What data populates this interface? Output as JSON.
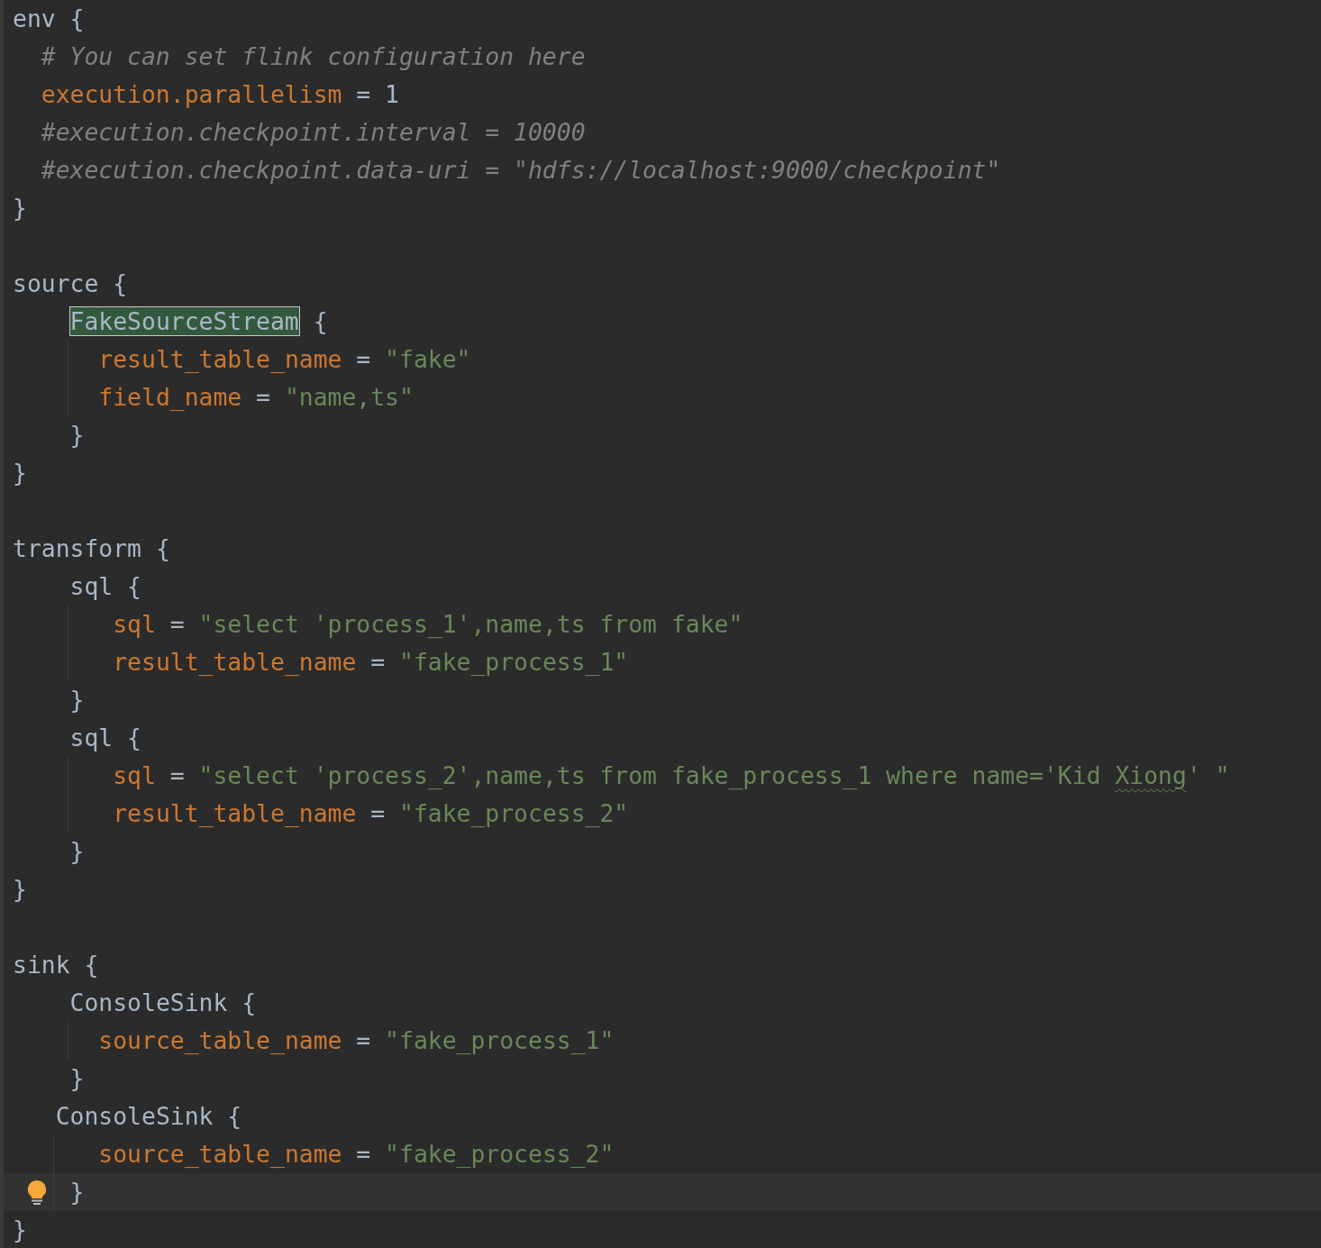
{
  "editor": {
    "lines": [
      {
        "current": false,
        "kind": "top",
        "tokens": [
          {
            "kind": "plain",
            "text": "env {"
          }
        ]
      },
      {
        "current": false,
        "kind": "property",
        "tokens": [
          {
            "kind": "comment",
            "text": "# You can set flink configuration here"
          }
        ]
      },
      {
        "current": false,
        "kind": "property",
        "tokens": [
          {
            "kind": "key",
            "text": "execution.parallelism"
          },
          {
            "kind": "plain",
            "text": " = "
          },
          {
            "kind": "number",
            "text": "1"
          }
        ]
      },
      {
        "current": false,
        "kind": "property",
        "tokens": [
          {
            "kind": "comment",
            "text": "#execution.checkpoint.interval = 10000"
          }
        ]
      },
      {
        "current": false,
        "kind": "property",
        "tokens": [
          {
            "kind": "comment",
            "text": "#execution.checkpoint.data-uri = \"hdfs://localhost:9000/checkpoint\""
          }
        ]
      },
      {
        "current": false,
        "kind": "top",
        "tokens": [
          {
            "kind": "plain",
            "text": "}"
          }
        ]
      },
      {
        "current": false,
        "kind": "top"
      },
      {
        "current": false,
        "kind": "top",
        "tokens": [
          {
            "kind": "plain",
            "text": "source {"
          }
        ]
      },
      {
        "current": false,
        "kind": "block",
        "tokens": [
          {
            "kind": "match",
            "text": "FakeSourceStream"
          },
          {
            "kind": "plain",
            "text": " {"
          }
        ]
      },
      {
        "current": false,
        "kind": "block-property",
        "guide": true,
        "tokens": [
          {
            "kind": "key",
            "text": "result_table_name"
          },
          {
            "kind": "plain",
            "text": " = "
          },
          {
            "kind": "string",
            "text": "\"fake\""
          }
        ]
      },
      {
        "current": false,
        "kind": "block-property",
        "guide": true,
        "tokens": [
          {
            "kind": "key",
            "text": "field_name"
          },
          {
            "kind": "plain",
            "text": " = "
          },
          {
            "kind": "string",
            "text": "\"name,ts\""
          }
        ]
      },
      {
        "current": false,
        "kind": "block",
        "tokens": [
          {
            "kind": "plain",
            "text": "}"
          }
        ]
      },
      {
        "current": false,
        "kind": "top",
        "tokens": [
          {
            "kind": "plain",
            "text": "}"
          }
        ]
      },
      {
        "current": false,
        "kind": "top"
      },
      {
        "current": false,
        "kind": "top",
        "tokens": [
          {
            "kind": "plain",
            "text": "transform {"
          }
        ]
      },
      {
        "current": false,
        "kind": "block",
        "tokens": [
          {
            "kind": "plain",
            "text": "sql {"
          }
        ]
      },
      {
        "current": false,
        "kind": "sql-property",
        "guide": true,
        "tokens": [
          {
            "kind": "key",
            "text": "sql"
          },
          {
            "kind": "plain",
            "text": " = "
          },
          {
            "kind": "string",
            "text": "\"select 'process_1',name,ts from fake\""
          }
        ]
      },
      {
        "current": false,
        "kind": "sql-property",
        "guide": true,
        "tokens": [
          {
            "kind": "key",
            "text": "result_table_name"
          },
          {
            "kind": "plain",
            "text": " = "
          },
          {
            "kind": "string",
            "text": "\"fake_process_1\""
          }
        ]
      },
      {
        "current": false,
        "kind": "block",
        "tokens": [
          {
            "kind": "plain",
            "text": "}"
          }
        ]
      },
      {
        "current": false,
        "kind": "block",
        "tokens": [
          {
            "kind": "plain",
            "text": "sql {"
          }
        ]
      },
      {
        "current": false,
        "kind": "sql-property",
        "guide": true,
        "tokens": [
          {
            "kind": "key",
            "text": "sql"
          },
          {
            "kind": "plain",
            "text": " = "
          },
          {
            "kind": "string",
            "text": "\"select 'process_2',name,ts from fake_process_1 where name='Kid "
          },
          {
            "kind": "typo",
            "text": "Xiong"
          },
          {
            "kind": "string",
            "text": "' \""
          }
        ]
      },
      {
        "current": false,
        "kind": "sql-property",
        "guide": true,
        "tokens": [
          {
            "kind": "key",
            "text": "result_table_name"
          },
          {
            "kind": "plain",
            "text": " = "
          },
          {
            "kind": "string",
            "text": "\"fake_process_2\""
          }
        ]
      },
      {
        "current": false,
        "kind": "block",
        "tokens": [
          {
            "kind": "plain",
            "text": "}"
          }
        ]
      },
      {
        "current": false,
        "kind": "top",
        "tokens": [
          {
            "kind": "plain",
            "text": "}"
          }
        ]
      },
      {
        "current": false,
        "kind": "top"
      },
      {
        "current": false,
        "kind": "top",
        "tokens": [
          {
            "kind": "plain",
            "text": "sink {"
          }
        ]
      },
      {
        "current": false,
        "kind": "block",
        "tokens": [
          {
            "kind": "plain",
            "text": "ConsoleSink {"
          }
        ]
      },
      {
        "current": false,
        "kind": "block-property",
        "guide": true,
        "tokens": [
          {
            "kind": "key",
            "text": "source_table_name"
          },
          {
            "kind": "plain",
            "text": " = "
          },
          {
            "kind": "string",
            "text": "\"fake_process_1\""
          }
        ]
      },
      {
        "current": false,
        "kind": "block",
        "tokens": [
          {
            "kind": "plain",
            "text": "}"
          }
        ]
      },
      {
        "current": false,
        "kind": "shifted-block",
        "tokens": [
          {
            "kind": "plain",
            "text": "ConsoleSink {"
          }
        ]
      },
      {
        "current": false,
        "kind": "shifted-property",
        "guide": true,
        "tokens": [
          {
            "kind": "key",
            "text": "source_table_name"
          },
          {
            "kind": "plain",
            "text": " = "
          },
          {
            "kind": "string",
            "text": "\"fake_process_2\""
          }
        ]
      },
      {
        "current": true,
        "kind": "shifted-close",
        "guide": true,
        "tokens": [
          {
            "kind": "plain",
            "text": "}"
          }
        ]
      },
      {
        "current": false,
        "kind": "top",
        "tokens": [
          {
            "kind": "plain",
            "text": "}"
          }
        ]
      }
    ]
  }
}
